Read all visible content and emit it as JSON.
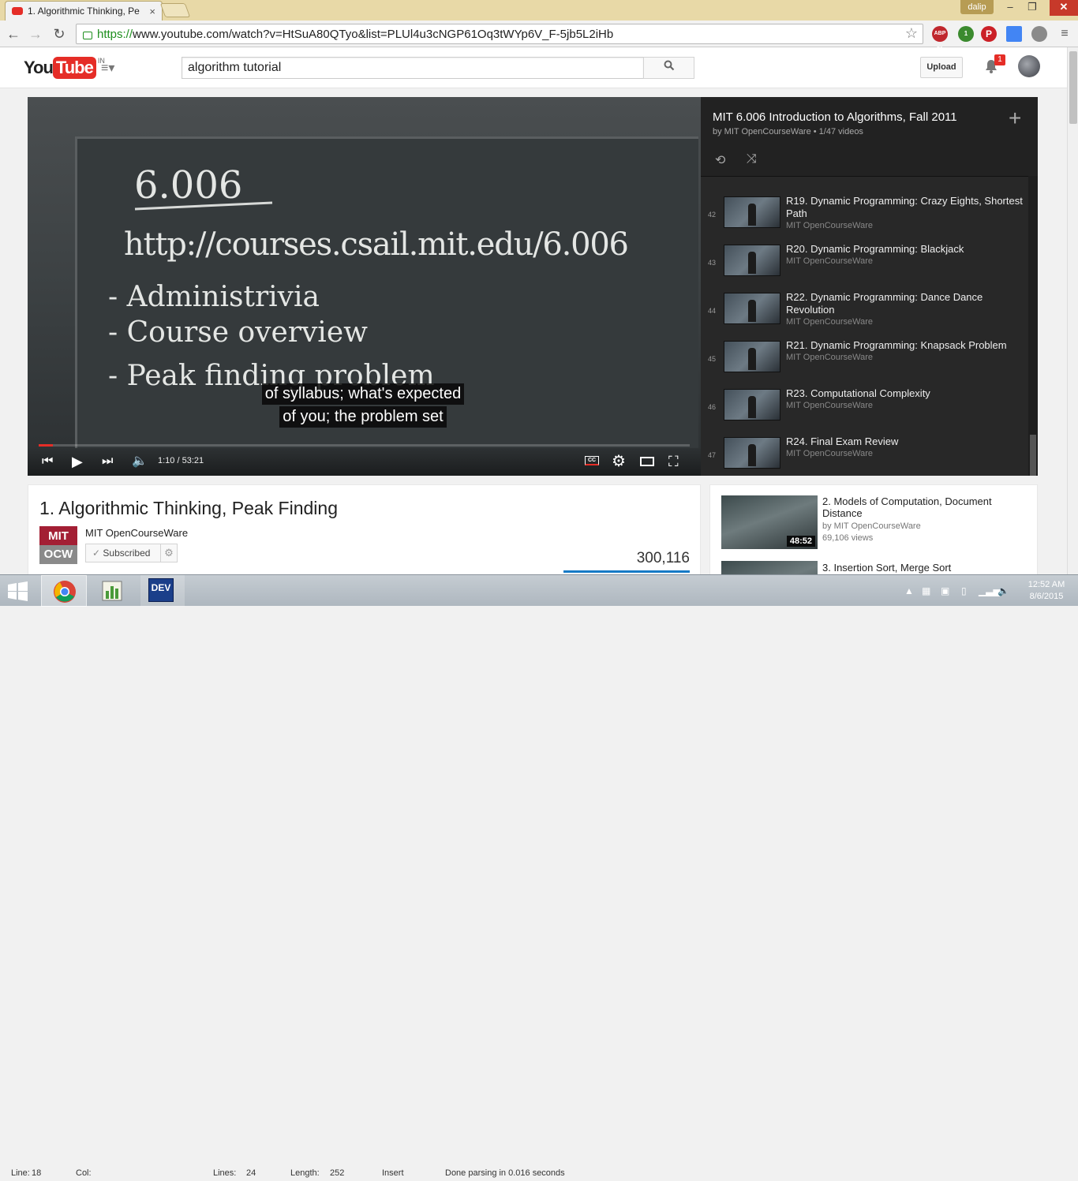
{
  "browser": {
    "tab_title": "1. Algorithmic Thinking, Pe",
    "tab_close": "×",
    "user_label": "dalip",
    "url_scheme": "https://",
    "url_rest": "www.youtube.com/watch?v=HtSuA80QTyo&list=PLUl4u3cNGP61Oq3tWYp6V_F-5jb5L2iHb",
    "abp_count": "ABP 51",
    "ext_badge": "1"
  },
  "youtube": {
    "logo_you": "You",
    "logo_tube": "Tube",
    "logo_region": "IN",
    "search_value": "algorithm tutorial",
    "upload_label": "Upload",
    "notification_count": "1"
  },
  "player": {
    "chalk": {
      "course": "6.006",
      "url": "http://courses.csail.mit.edu/6.006",
      "item1": "- Administrivia",
      "item2": "- Course overview",
      "item3": "- Peak finding problem"
    },
    "captions": [
      "of syllabus; what's expected",
      "of you; the problem set"
    ],
    "time": "1:10 / 53:21",
    "progress_fraction": 0.022,
    "cc_label": "CC"
  },
  "playlist": {
    "title": "MIT 6.006 Introduction to Algorithms, Fall 2011",
    "subtitle": "by MIT OpenCourseWare • 1/47 videos",
    "items": [
      {
        "index": "42",
        "title": "R19. Dynamic Programming: Crazy Eights, Shortest Path",
        "channel": "MIT OpenCourseWare"
      },
      {
        "index": "43",
        "title": "R20. Dynamic Programming: Blackjack",
        "channel": "MIT OpenCourseWare"
      },
      {
        "index": "44",
        "title": "R22. Dynamic Programming: Dance Dance Revolution",
        "channel": "MIT OpenCourseWare"
      },
      {
        "index": "45",
        "title": "R21. Dynamic Programming: Knapsack Problem",
        "channel": "MIT OpenCourseWare"
      },
      {
        "index": "46",
        "title": "R23. Computational Complexity",
        "channel": "MIT OpenCourseWare"
      },
      {
        "index": "47",
        "title": "R24. Final Exam Review",
        "channel": "MIT OpenCourseWare"
      }
    ]
  },
  "video": {
    "title": "1. Algorithmic Thinking, Peak Finding",
    "channel_logo_top": "MIT",
    "channel_logo_bottom": "OCW",
    "channel": "MIT OpenCourseWare",
    "subscribed_label": "Subscribed",
    "views": "300,116"
  },
  "related": [
    {
      "title": "2. Models of Computation, Document Distance",
      "channel": "by MIT OpenCourseWare",
      "views": "69,106 views",
      "duration": "48:52"
    },
    {
      "title": "3. Insertion Sort, Merge Sort",
      "channel": "",
      "views": "",
      "duration": ""
    }
  ],
  "statusbar": {
    "line": "Line:",
    "line_val": "18",
    "col": "Col:",
    "lines": "Lines:",
    "lines_val": "24",
    "length": "Length:",
    "length_val": "252",
    "mode": "Insert",
    "message": "Done parsing in 0.016 seconds"
  },
  "taskbar": {
    "dev_label": "DEV",
    "time": "12:52 AM",
    "date": "8/6/2015"
  },
  "colors": {
    "brand_red": "#e52d27",
    "link_blue": "#167ac6"
  }
}
